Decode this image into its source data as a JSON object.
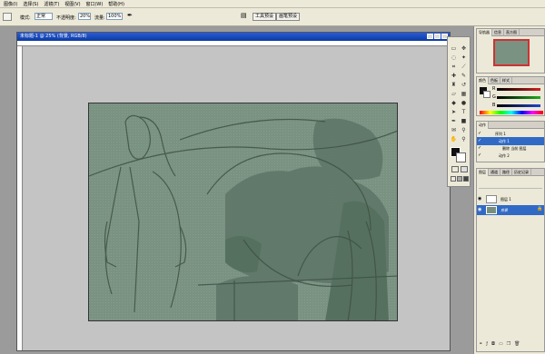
{
  "menubar": {
    "items": [
      "图像(I)",
      "选择(S)",
      "滤镜(T)",
      "视图(V)",
      "窗口(W)",
      "帮助(H)"
    ]
  },
  "options": {
    "mode_label": "模式:",
    "mode_value": "正常",
    "opacity_label": "不透明度:",
    "opacity_value": "20%",
    "flow_label": "流量:",
    "flow_value": "100%",
    "tab_tools": "工具预设",
    "tab_brushes": "画笔预设"
  },
  "document": {
    "title": "未标题-1 @ 25% (背景, RGB/8)"
  },
  "navigator": {
    "tabs": [
      "导航器",
      "信息",
      "直方图"
    ]
  },
  "color": {
    "tabs": [
      "颜色",
      "色板",
      "样式"
    ],
    "r": "R",
    "g": "G",
    "b": "B",
    "r_color": "#cc2222",
    "g_color": "#22aa22",
    "b_color": "#2244cc"
  },
  "actions": {
    "tabs": [
      "动作"
    ],
    "items": [
      "序列 1",
      "动作 1",
      "删除 当前 图层",
      "动作 2"
    ]
  },
  "layers": {
    "tabs": [
      "图层",
      "通道",
      "路径",
      "历史记录"
    ],
    "items": [
      "图层 1",
      "背景"
    ]
  },
  "colors": {
    "canvas": "#788f80",
    "accent": "#316ac5"
  }
}
